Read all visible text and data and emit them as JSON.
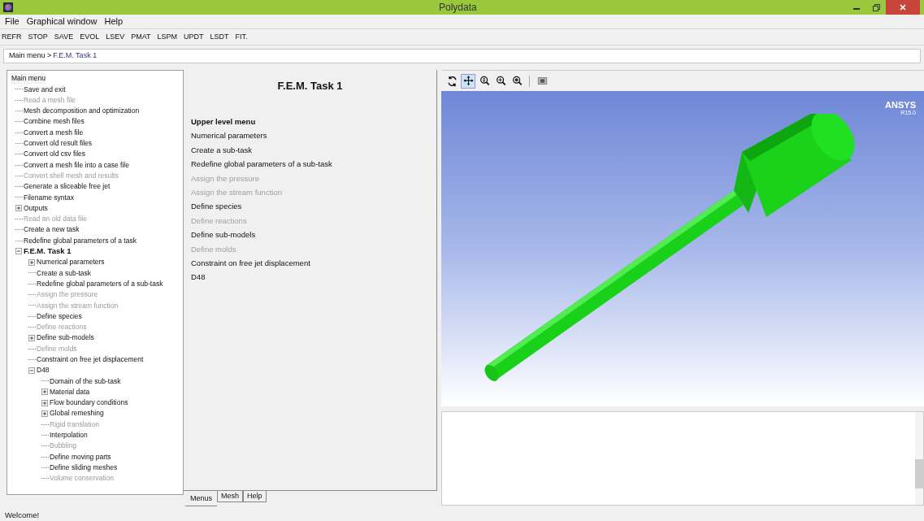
{
  "window": {
    "title": "Polydata"
  },
  "menu_bar": [
    "File",
    "Graphical window",
    "Help"
  ],
  "toolbar": [
    "REFR",
    "STOP",
    "SAVE",
    "EVOL",
    "LSEV",
    "PMAT",
    "LSPM",
    "UPDT",
    "LSDT",
    "FIT."
  ],
  "breadcrumb": {
    "root": "Main menu >",
    "current": "F.E.M. Task  1"
  },
  "tree": {
    "root": "Main menu",
    "items": [
      {
        "label": "Save and exit",
        "disabled": false,
        "current": false
      },
      {
        "label": "Read a mesh file",
        "disabled": true,
        "current": false
      },
      {
        "label": "Mesh decomposition and optimization",
        "disabled": false,
        "current": false
      },
      {
        "label": "Combine mesh files",
        "disabled": false,
        "current": false
      },
      {
        "label": "Convert a mesh file",
        "disabled": false,
        "current": false
      },
      {
        "label": "Convert old result files",
        "disabled": false,
        "current": false
      },
      {
        "label": "Convert old csv files",
        "disabled": false,
        "current": false
      },
      {
        "label": "Convert a mesh file into a case file",
        "disabled": false,
        "current": false
      },
      {
        "label": "Convert shell mesh and results",
        "disabled": true,
        "current": false
      },
      {
        "label": "Generate a sliceable free jet",
        "disabled": false,
        "current": false
      },
      {
        "label": "Filename syntax",
        "disabled": false,
        "current": false
      },
      {
        "label": "Outputs",
        "disabled": false,
        "current": false,
        "expanded": false
      },
      {
        "label": "Read an old data file",
        "disabled": true,
        "current": false
      },
      {
        "label": "Create a new task",
        "disabled": false,
        "current": false
      },
      {
        "label": "Redefine global parameters of a task",
        "disabled": false,
        "current": false
      },
      {
        "label": "F.E.M. Task  1",
        "disabled": false,
        "current": true,
        "expanded": true,
        "children": [
          {
            "label": "Numerical parameters",
            "disabled": false,
            "expanded": false
          },
          {
            "label": "Create a sub-task",
            "disabled": false
          },
          {
            "label": "Redefine global parameters of a sub-task",
            "disabled": false
          },
          {
            "label": "Assign the pressure",
            "disabled": true
          },
          {
            "label": "Assign the stream function",
            "disabled": true
          },
          {
            "label": "Define species",
            "disabled": false
          },
          {
            "label": "Define reactions",
            "disabled": true
          },
          {
            "label": "Define sub-models",
            "disabled": false,
            "expanded": false
          },
          {
            "label": "Define molds",
            "disabled": true
          },
          {
            "label": "Constraint on free jet displacement",
            "disabled": false
          },
          {
            "label": "D48",
            "disabled": false,
            "expanded": true,
            "children": [
              {
                "label": "Domain of the sub-task",
                "disabled": false
              },
              {
                "label": "Material data",
                "disabled": false,
                "expanded": false
              },
              {
                "label": "Flow boundary conditions",
                "disabled": false,
                "expanded": false
              },
              {
                "label": "Global remeshing",
                "disabled": false,
                "expanded": false
              },
              {
                "label": "Rigid translation",
                "disabled": true
              },
              {
                "label": "Interpolation",
                "disabled": false
              },
              {
                "label": "Bubbling",
                "disabled": true
              },
              {
                "label": "Define moving parts",
                "disabled": false
              },
              {
                "label": "Define sliding meshes",
                "disabled": false
              },
              {
                "label": "Volume conservation",
                "disabled": true
              }
            ]
          }
        ]
      }
    ]
  },
  "menu_panel": {
    "title": "F.E.M. Task  1",
    "items": [
      {
        "label": "Upper level menu",
        "kind": "up",
        "disabled": false
      },
      {
        "label": "Numerical parameters",
        "kind": "item",
        "disabled": false
      },
      {
        "label": "Create a sub-task",
        "kind": "item",
        "disabled": false
      },
      {
        "label": "Redefine global parameters of a sub-task",
        "kind": "item",
        "disabled": false
      },
      {
        "label": "Assign the pressure",
        "kind": "item",
        "disabled": true
      },
      {
        "label": "Assign the stream function",
        "kind": "item",
        "disabled": true
      },
      {
        "label": "Define species",
        "kind": "item",
        "disabled": false
      },
      {
        "label": "Define reactions",
        "kind": "item",
        "disabled": true
      },
      {
        "label": "Define sub-models",
        "kind": "item",
        "disabled": false
      },
      {
        "label": "Define molds",
        "kind": "item",
        "disabled": true
      },
      {
        "label": "Constraint on free jet displacement",
        "kind": "item",
        "disabled": false
      },
      {
        "label": "D48",
        "kind": "item",
        "disabled": false
      }
    ]
  },
  "panel_tabs": [
    {
      "label": "Menus",
      "selected": true
    },
    {
      "label": "Mesh",
      "selected": false
    },
    {
      "label": "Help",
      "selected": false
    }
  ],
  "view_toolbar": [
    {
      "kind": "rotate",
      "selected": false
    },
    {
      "kind": "pan",
      "selected": true
    },
    {
      "kind": "zoom",
      "selected": false
    },
    {
      "kind": "zoom-in",
      "selected": false
    },
    {
      "kind": "zoom-fit",
      "selected": false
    },
    {
      "kind": "snapshot",
      "selected": false
    }
  ],
  "viewport": {
    "logo": "ANSYS",
    "version": "R15.0"
  },
  "status_bar": "Welcome!"
}
